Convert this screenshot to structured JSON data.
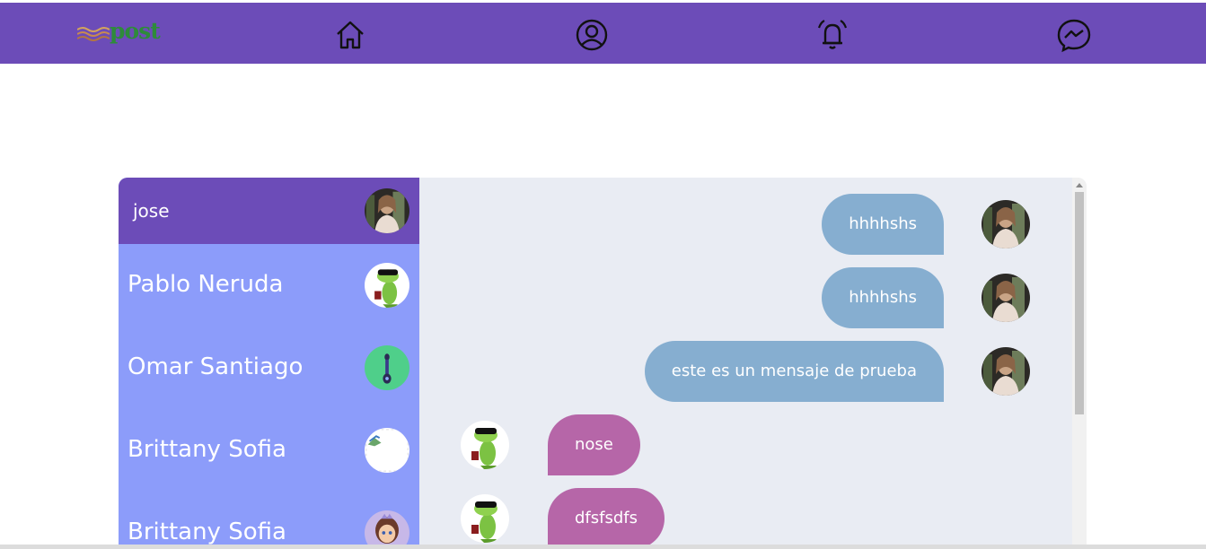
{
  "header": {
    "logo_text": "post",
    "nav": [
      {
        "name": "home-icon"
      },
      {
        "name": "profile-icon"
      },
      {
        "name": "notifications-icon"
      },
      {
        "name": "messenger-icon"
      }
    ]
  },
  "contacts": [
    {
      "name": "jose",
      "active": true,
      "avatar": "woman-photo"
    },
    {
      "name": "Pablo Neruda",
      "avatar": "lizard-sunglasses"
    },
    {
      "name": "Omar Santiago",
      "avatar": "green-circle-figure"
    },
    {
      "name": "Brittany Sofia",
      "avatar": "broken-image"
    },
    {
      "name": "Brittany Sofia",
      "avatar": "cartoon-princess"
    }
  ],
  "messages": [
    {
      "text": "hhhhshs",
      "direction": "out",
      "avatar": "woman-photo"
    },
    {
      "text": "hhhhshs",
      "direction": "out",
      "avatar": "woman-photo"
    },
    {
      "text": "este es un mensaje de prueba",
      "direction": "out",
      "avatar": "woman-photo"
    },
    {
      "text": "nose",
      "direction": "in",
      "avatar": "lizard-sunglasses"
    },
    {
      "text": "dfsfsdfs",
      "direction": "in",
      "avatar": "lizard-sunglasses"
    }
  ],
  "colors": {
    "header": "#6c4cb8",
    "contact_list": "#8c9cfa",
    "active_contact": "#6c4cb8",
    "chat_background": "#e9ecf3",
    "outgoing_bubble": "#86aed0",
    "incoming_bubble": "#b666a8",
    "logo_green": "#2e8b3a"
  }
}
